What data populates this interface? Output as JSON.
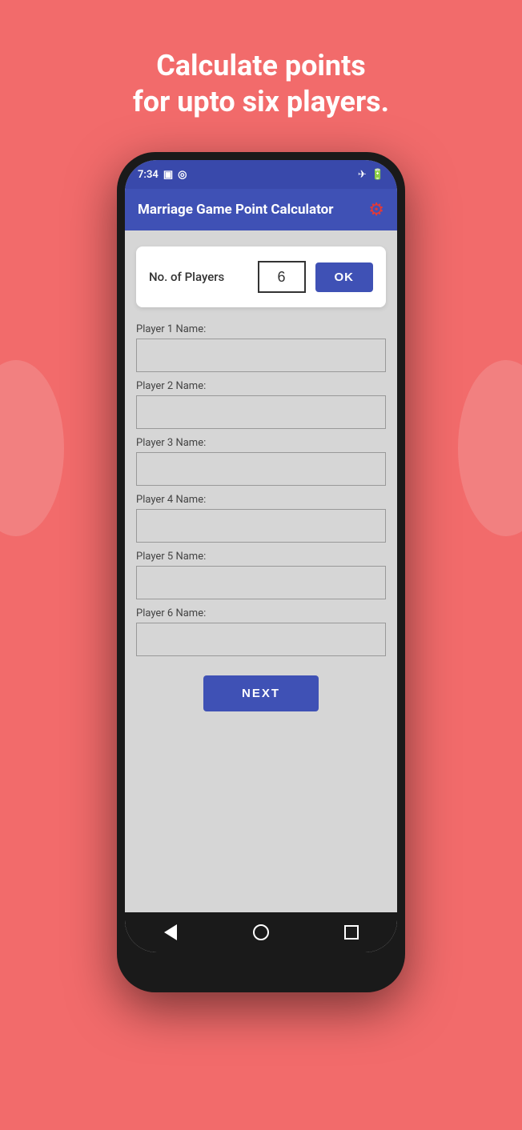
{
  "background": {
    "headline_line1": "Calculate points",
    "headline_line2": "for upto six players."
  },
  "status_bar": {
    "time": "7:34",
    "airplane_icon": "✈",
    "battery_icon": "🔋"
  },
  "toolbar": {
    "title": "Marriage Game Point Calculator",
    "settings_icon": "⚙"
  },
  "players_card": {
    "label": "No. of Players",
    "value": "6",
    "ok_label": "OK"
  },
  "player_fields": [
    {
      "label": "Player 1 Name:",
      "placeholder": ""
    },
    {
      "label": "Player 2 Name:",
      "placeholder": ""
    },
    {
      "label": "Player 3 Name:",
      "placeholder": ""
    },
    {
      "label": "Player 4 Name:",
      "placeholder": ""
    },
    {
      "label": "Player 5 Name:",
      "placeholder": ""
    },
    {
      "label": "Player 6 Name:",
      "placeholder": ""
    }
  ],
  "next_button_label": "NEXT"
}
